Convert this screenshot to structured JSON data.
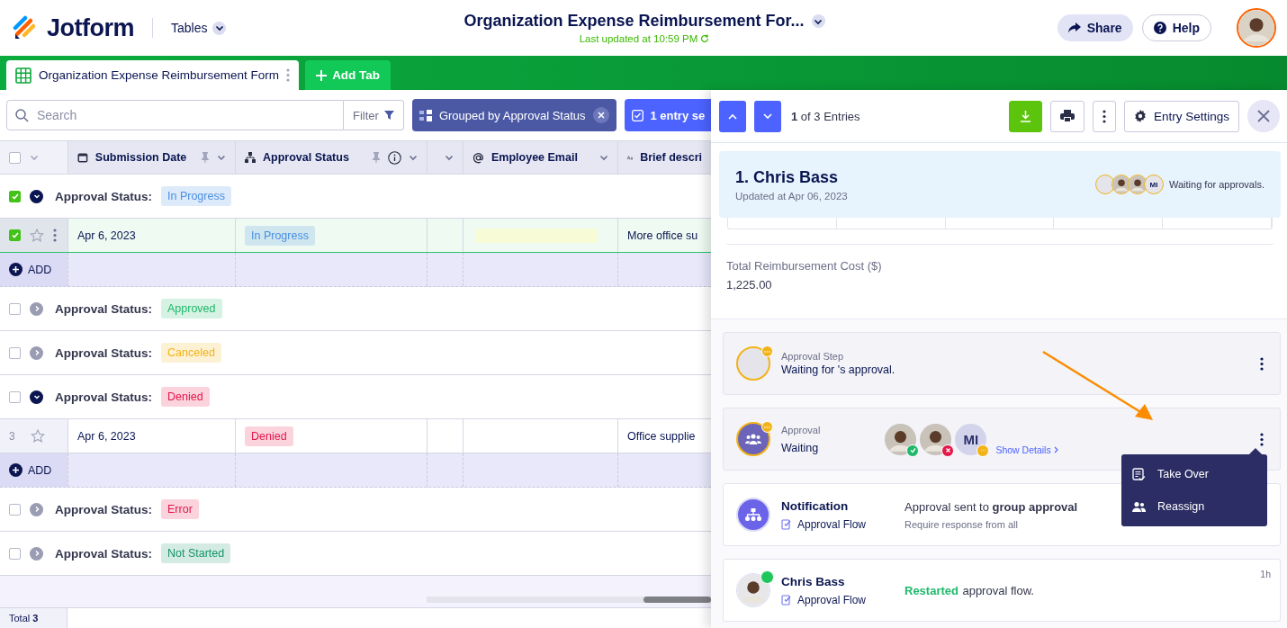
{
  "header": {
    "logo": "Jotform",
    "tables_menu": "Tables",
    "title": "Organization Expense Reimbursement For...",
    "last_updated": "Last updated at 10:59 PM",
    "share": "Share",
    "help": "Help"
  },
  "tabs": [
    {
      "label": "Organization Expense Reimbursement Form",
      "selected": true
    }
  ],
  "add_tab": "Add Tab",
  "toolbar": {
    "search": {
      "placeholder": "Search"
    },
    "filter": "Filter",
    "grouping": "Grouped by Approval Status",
    "selection": "1 entry se"
  },
  "table": {
    "all_checked": false,
    "columns": [
      {
        "label": "Submission Date",
        "kind": "date",
        "pinned": true,
        "info": false
      },
      {
        "label": "Approval Status",
        "kind": "flow",
        "pinned": true,
        "info": true
      },
      {
        "kind": "blank"
      },
      {
        "label": "Employee Email",
        "kind": "email",
        "pinned": false,
        "info": false
      },
      {
        "label": "Brief descri",
        "kind": "text",
        "pinned": false,
        "info": false
      }
    ],
    "groups": [
      {
        "label": "Approval Status:",
        "status": "In Progress",
        "color": "#4a90e2",
        "checked": true,
        "expanded": true,
        "add": "ADD",
        "rows": [
          {
            "checked": true,
            "starred": false,
            "date": "Apr 6, 2023",
            "status": "In Progress",
            "color": "#4a90e2",
            "description": "More office su"
          }
        ]
      },
      {
        "label": "Approval Status:",
        "status": "Approved",
        "color": "#1fb86b",
        "checked": false,
        "expanded": false
      },
      {
        "label": "Approval Status:",
        "status": "Canceled",
        "color": "#f2b318",
        "checked": false,
        "expanded": false
      },
      {
        "label": "Approval Status:",
        "status": "Denied",
        "color": "#e3174a",
        "checked": false,
        "expanded": true,
        "add": "ADD",
        "rows": [
          {
            "checked": false,
            "number": "3",
            "starred": false,
            "date": "Apr 6, 2023",
            "status": "Denied",
            "color": "#e3174a",
            "description": "Office supplie"
          }
        ]
      },
      {
        "label": "Approval Status:",
        "status": "Error",
        "color": "#e3174a",
        "checked": false,
        "expanded": false
      },
      {
        "label": "Approval Status:",
        "status": "Not Started",
        "color": "#17946b",
        "checked": false,
        "expanded": false
      }
    ],
    "total": "Total **3**"
  },
  "drawer": {
    "position": "**1** of 3 Entries",
    "entry_settings": "Entry Settings",
    "entry": {
      "title": "1. Chris Bass",
      "updated": "Updated at Apr 06, 2023",
      "approvers": [
        {
          "kind": "empty"
        },
        {
          "kind": "photo"
        },
        {
          "kind": "photo"
        },
        {
          "kind": "initials",
          "initials": "MI"
        }
      ],
      "status": "Waiting for approvals."
    },
    "fields": [
      {
        "label": "Total Reimbursement Cost ($)",
        "value": "1,225.00"
      }
    ],
    "timeline": [
      {
        "kind": "step",
        "title": "Approval Step",
        "text": "Waiting for 's approval."
      },
      {
        "kind": "approval",
        "title": "Approval",
        "text": "Waiting",
        "details": "Show Details",
        "approvers": [
          {
            "kind": "photo",
            "badge": {
              "kind": "approved",
              "color": "#1fb86b"
            }
          },
          {
            "kind": "photo",
            "badge": {
              "kind": "denied",
              "color": "#e3174a"
            }
          },
          {
            "kind": "initials",
            "initials": "MI",
            "badge": {
              "kind": "waiting",
              "color": "#f2b318"
            }
          }
        ],
        "menu": [
          "Take Over",
          "Reassign"
        ]
      },
      {
        "kind": "notification",
        "title": "Notification",
        "source": "Approval Flow",
        "text": "Approval sent to **group approval**",
        "subtext": "Require response from all"
      },
      {
        "kind": "user",
        "title": "Chris Bass",
        "source": "Approval Flow",
        "action": "Restarted",
        "text": "approval flow.",
        "time": "1h",
        "online": true
      }
    ]
  }
}
